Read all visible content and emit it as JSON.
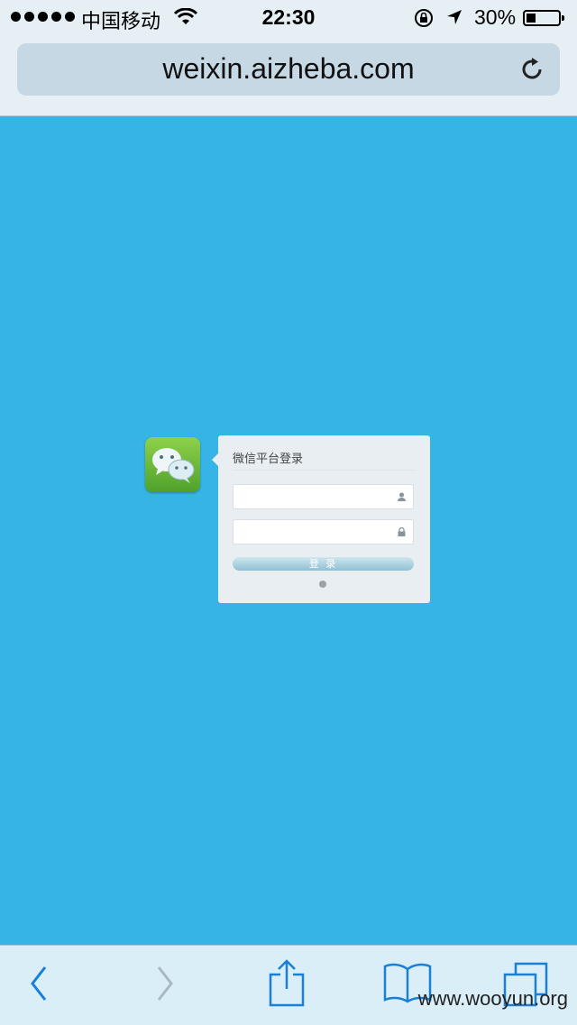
{
  "status_bar": {
    "carrier": "中国移动",
    "time": "22:30",
    "battery": "30%"
  },
  "browser": {
    "url": "weixin.aizheba.com"
  },
  "login": {
    "title": "微信平台登录",
    "username_value": "",
    "password_value": "",
    "button_label": "登 录"
  },
  "watermark": "www.wooyun.org",
  "colors": {
    "background": "#37b4e6",
    "toolbar": "#d9eef7",
    "accent": "#1a7fd6"
  }
}
